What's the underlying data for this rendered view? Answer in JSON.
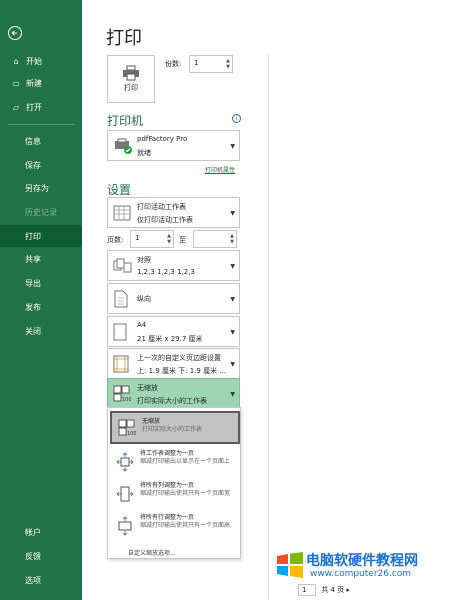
{
  "sidebar": {
    "items": [
      {
        "label": "开始",
        "icon": "home-icon",
        "glyph": "⌂"
      },
      {
        "label": "新建",
        "icon": "new-file-icon",
        "glyph": "▭"
      },
      {
        "label": "打开",
        "icon": "open-folder-icon",
        "glyph": "▱"
      },
      {
        "label": "信息"
      },
      {
        "label": "保存"
      },
      {
        "label": "另存为"
      },
      {
        "label": "历史记录"
      },
      {
        "label": "打印"
      },
      {
        "label": "共享"
      },
      {
        "label": "导出"
      },
      {
        "label": "发布"
      },
      {
        "label": "关闭"
      },
      {
        "label": "帐户"
      },
      {
        "label": "反馈"
      },
      {
        "label": "选项"
      }
    ]
  },
  "page": {
    "title": "打印"
  },
  "print": {
    "button_label": "打印",
    "copies_label": "份数:",
    "copies_value": "1"
  },
  "printer": {
    "heading": "打印机",
    "name": "pdfFactory Pro",
    "status": "就绪",
    "properties_link": "打印机属性"
  },
  "settings": {
    "heading": "设置",
    "what": {
      "line1": "打印活动工作表",
      "line2": "仅打印活动工作表"
    },
    "pages_label": "页数:",
    "pages_from": "1",
    "to_label": "至",
    "pages_to": "",
    "collate": {
      "line1": "对照",
      "line2": "1,2,3     1,2,3     1,2,3"
    },
    "orientation": {
      "line1": "纵向"
    },
    "paper": {
      "line1": "A4",
      "line2": "21 厘米 x 29.7 厘米"
    },
    "margins": {
      "line1": "上一次的自定义页边距设置",
      "line2": "上: 1.9 厘米 下: 1.9 厘米 ..."
    },
    "scaling": {
      "line1": "无缩放",
      "line2": "打印实际大小的工作表"
    }
  },
  "scaling_menu": {
    "items": [
      {
        "title": "无缩放",
        "desc": "打印实际大小的工作表"
      },
      {
        "title": "将工作表调整为一页",
        "desc": "缩减打印输出以显示在一个页面上"
      },
      {
        "title": "将所有列调整为一页",
        "desc": "缩减打印输出使其只有一个页面宽"
      },
      {
        "title": "将所有行调整为一页",
        "desc": "缩减打印输出使其只有一个页面高"
      }
    ],
    "custom": "自定义缩放选项..."
  },
  "watermark": {
    "title": "电脑软硬件教程网",
    "url": "www.computer26.com"
  },
  "pager": {
    "current": "1",
    "total": "共 4 页",
    "next": "▸"
  },
  "colors": {
    "accent": "#217346",
    "selected": "#9fd5b2"
  }
}
